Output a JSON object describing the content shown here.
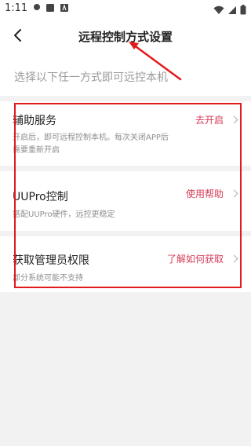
{
  "status_bar": {
    "time": "1:11",
    "icons": [
      "notification-dot-icon",
      "image-icon",
      "a-letter-icon",
      "wifi-icon",
      "signal-icon",
      "battery-icon"
    ]
  },
  "header": {
    "title": "远程控制方式设置",
    "back_icon": "chevron-left-icon"
  },
  "hint": "选择以下任一方式即可远控本机",
  "items": [
    {
      "title": "辅助服务",
      "desc_line1": "开启后，即可远程控制本机。每次关闭APP后",
      "desc_line2": "需要重新开启",
      "action": "去开启"
    },
    {
      "title": "UUPro控制",
      "desc_line1": "搭配UUPro硬件，远控更稳定",
      "action": "使用帮助"
    },
    {
      "title": "获取管理员权限",
      "desc_line1": "部分系统可能不支持",
      "action": "了解如何获取"
    }
  ],
  "colors": {
    "accent": "#d63a57",
    "annotation": "#e31a1c",
    "divider": "#f2f2f2",
    "hint": "#9a9a9a"
  }
}
